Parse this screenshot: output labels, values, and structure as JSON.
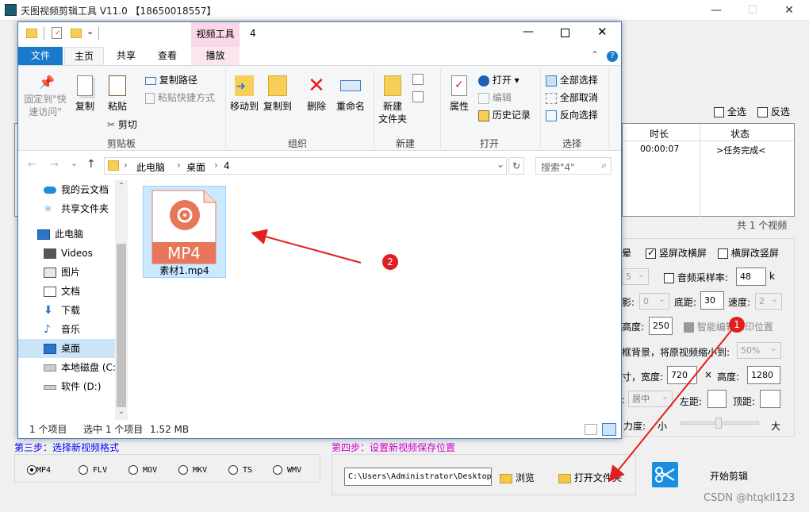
{
  "app": {
    "title": "天图视频剪辑工具 V11.0 【18650018557】",
    "minimize": "—",
    "maximize": "☐",
    "close": "✕"
  },
  "behind": {
    "select_all": "全选",
    "invert_select": "反选",
    "table_headers": [
      "时长",
      "状态"
    ],
    "table_rows": [
      {
        "duration": "00:00:07",
        "status": ">任务完成<"
      }
    ],
    "count_text": "共 1 个视频",
    "opt_row1_a": "晕",
    "vertical_to_horizontal": "竖屏改横屏",
    "horizontal_to_vertical": "横屏改竖屏",
    "sample_rate_select": "5",
    "audio_sample_rate_label": "音频采样率:",
    "audio_sample_rate_value": "48",
    "audio_unit": "k",
    "row3_prefix": "影:",
    "row3_select": "0",
    "bottom_margin_label": "底距:",
    "bottom_margin_value": "30",
    "speed_label": "速度:",
    "speed_select": "2",
    "height_label": "高度:",
    "height_value": "250",
    "smart_edit_label": "智能编辑水印位置",
    "frame_bg_label": "框背景，将原视频缩小到:",
    "scale_select": "50%",
    "size_prefix": "寸，宽度:",
    "width_value": "720",
    "times": "×",
    "height2_label": "高度:",
    "height2_value": "1280",
    "align_prefix": ":",
    "align_select": "居中",
    "left_label": "左距:",
    "top_label": "顶距:",
    "strength_label": "力度:",
    "small": "小",
    "large": "大",
    "step3": "第三步：选择新视频格式",
    "step4": "第四步：设置新视频保存位置",
    "formats": [
      "MP4",
      "FLV",
      "MOV",
      "MKV",
      "TS",
      "WMV"
    ],
    "selected_format": "MP4",
    "save_path": "C:\\Users\\Administrator\\Desktop\\",
    "browse": "浏览",
    "open_folder": "打开文件夹",
    "start": "开始剪辑",
    "watermark": "CSDN @htqkll123"
  },
  "explorer": {
    "qat_dropdown": "⌄",
    "context_tab": "视频工具",
    "folder_title": "4",
    "tabs": [
      "文件",
      "主页",
      "共享",
      "查看",
      "播放"
    ],
    "ribbon": {
      "pin": "固定到\"快\n速访问\"",
      "copy": "复制",
      "paste": "粘贴",
      "copy_path": "复制路径",
      "paste_shortcut": "粘贴快捷方式",
      "cut": "剪切",
      "clipboard_group": "剪贴板",
      "move_to": "移动到",
      "copy_to": "复制到",
      "delete": "删除",
      "rename": "重命名",
      "organize_group": "组织",
      "new_folder": "新建\n文件夹",
      "new_group": "新建",
      "properties": "属性",
      "open": "打开",
      "edit": "编辑",
      "history": "历史记录",
      "open_group": "打开",
      "select_all": "全部选择",
      "select_none": "全部取消",
      "invert": "反向选择",
      "select_group": "选择"
    },
    "breadcrumb": [
      "此电脑",
      "桌面",
      "4"
    ],
    "search_placeholder": "搜索\"4\"",
    "tree": [
      "我的云文档",
      "共享文件夹",
      "此电脑",
      "Videos",
      "图片",
      "文档",
      "下载",
      "音乐",
      "桌面",
      "本地磁盘 (C:",
      "软件 (D:)"
    ],
    "file": {
      "badge": "MP4",
      "name": "素材1.mp4"
    },
    "status_items": "1 个项目",
    "status_selected": "选中 1 个项目",
    "status_size": "1.52 MB"
  },
  "annotations": [
    "1",
    "2"
  ],
  "colors": {
    "accent": "#1979ca",
    "red": "#e02020",
    "context_tab": "#f8d7e6",
    "step_blue": "#0000ff",
    "step_magenta": "#cc00cc"
  }
}
